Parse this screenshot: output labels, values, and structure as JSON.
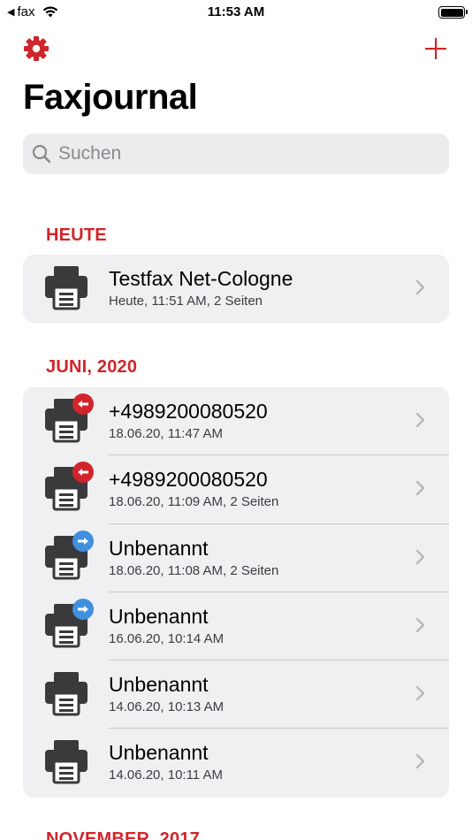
{
  "status_bar": {
    "back_label": "fax",
    "time": "11:53 AM"
  },
  "header": {
    "title": "Faxjournal",
    "settings_icon": "gear-icon",
    "add_icon": "plus-icon"
  },
  "search": {
    "placeholder": "Suchen"
  },
  "colors": {
    "accent": "#d0252b",
    "incoming_badge": "#d0252b",
    "outgoing_badge": "#3f90df",
    "printer": "#3a3a3c"
  },
  "sections": [
    {
      "title": "HEUTE",
      "items": [
        {
          "title": "Testfax Net-Cologne",
          "subtitle": "Heute, 11:51 AM, 2 Seiten",
          "badge": "none"
        }
      ]
    },
    {
      "title": "JUNI, 2020",
      "items": [
        {
          "title": "+4989200080520",
          "subtitle": "18.06.20, 11:47 AM",
          "badge": "incoming"
        },
        {
          "title": "+4989200080520",
          "subtitle": "18.06.20, 11:09 AM, 2 Seiten",
          "badge": "incoming"
        },
        {
          "title": "Unbenannt",
          "subtitle": "18.06.20, 11:08 AM, 2 Seiten",
          "badge": "outgoing"
        },
        {
          "title": "Unbenannt",
          "subtitle": "16.06.20, 10:14 AM",
          "badge": "outgoing"
        },
        {
          "title": "Unbenannt",
          "subtitle": "14.06.20, 10:13 AM",
          "badge": "none"
        },
        {
          "title": "Unbenannt",
          "subtitle": "14.06.20, 10:11 AM",
          "badge": "none"
        }
      ]
    },
    {
      "title": "NOVEMBER, 2017",
      "items": []
    }
  ]
}
